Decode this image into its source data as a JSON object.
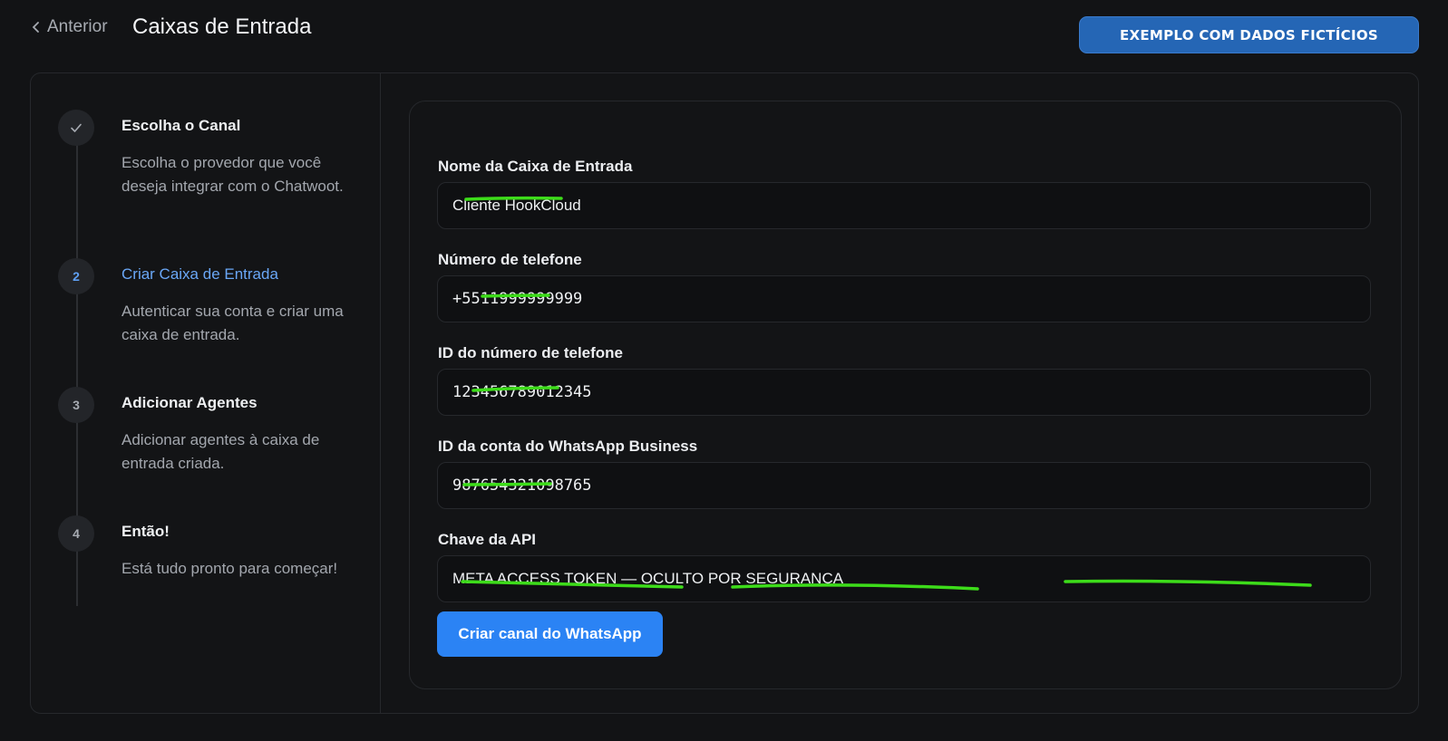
{
  "header": {
    "back_label": "Anterior",
    "title": "Caixas de Entrada",
    "badge_label": "EXEMPLO COM DADOS FICTÍCIOS"
  },
  "steps": [
    {
      "number": "",
      "icon": "check-icon",
      "title": "Escolha o Canal",
      "description": "Escolha o provedor que você deseja integrar com o Chatwoot.",
      "state": "done"
    },
    {
      "number": "2",
      "title": "Criar Caixa de Entrada",
      "description": "Autenticar sua conta e criar uma caixa de entrada.",
      "state": "active"
    },
    {
      "number": "3",
      "title": "Adicionar Agentes",
      "description": "Adicionar agentes à caixa de entrada criada.",
      "state": "pending"
    },
    {
      "number": "4",
      "title": "Então!",
      "description": "Está tudo pronto para começar!",
      "state": "pending"
    }
  ],
  "form": {
    "inbox_name": {
      "label": "Nome da Caixa de Entrada",
      "value": "Cliente HookCloud"
    },
    "phone_number": {
      "label": "Número de telefone",
      "value": "+5511999999999"
    },
    "phone_number_id": {
      "label": "ID do número de telefone",
      "value": "123456789012345"
    },
    "business_account_id": {
      "label": "ID da conta do WhatsApp Business",
      "value": "987654321098765"
    },
    "api_key": {
      "label": "Chave da API",
      "value": "META ACCESS TOKEN — OCULTO POR SEGURANÇA"
    },
    "submit_label": "Criar canal do WhatsApp"
  },
  "colors": {
    "accent": "#2b83f4",
    "active_step": "#6aa7f6",
    "badge": "#2566b5",
    "annotation": "#3ddc1a"
  }
}
